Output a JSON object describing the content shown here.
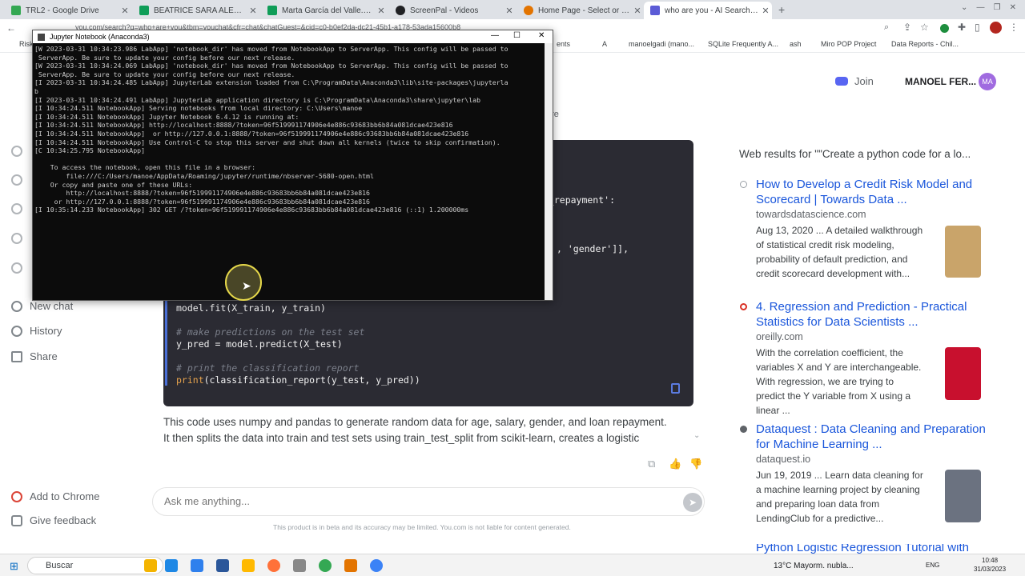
{
  "browser": {
    "tabs": [
      {
        "title": "TRL2 - Google Drive",
        "color": "#34a853"
      },
      {
        "title": "BEATRICE SARA ALEXANDRA.xlsx",
        "color": "#0f9d58"
      },
      {
        "title": "Marta García del Valle.xlsx - Goo",
        "color": "#0f9d58"
      },
      {
        "title": "ScreenPal - Videos",
        "color": "#202124"
      },
      {
        "title": "Home Page - Select or create a",
        "color": "#e37400"
      },
      {
        "title": "who are you - AI Search Based C",
        "color": "#5b5bd6"
      }
    ],
    "url": "you.com/search?q=who+are+you&tbm=youchat&cfr=chat&chatGuest=&cid=c0-b0ef2da-dc21-45b1-a178-53ada15600b8",
    "bookmarks": [
      "Risk",
      "ents",
      "A",
      "manoelgadi (mano...",
      "SQLite Frequently A...",
      "ash",
      "Miro POP Project",
      "Data Reports - Chil..."
    ]
  },
  "header": {
    "join_label": "Join",
    "user_name": "MANOEL FER...",
    "avatar_initials": "MA",
    "more_label": "ore"
  },
  "sidebar": {
    "new_chat": "New chat",
    "history": "History",
    "share": "Share",
    "add_to_chrome": "Add to Chrome",
    "give_feedback": "Give feedback"
  },
  "code": {
    "frag_repayment": "n_repayment':",
    "frag_gender": ", 'gender']],",
    "line_fit": "model.fit(X_train, y_train)",
    "comment_predict": "# make predictions on the test set",
    "line_predict": "y_pred = model.predict(X_test)",
    "comment_print": "# print the classification report",
    "print_kw": "print",
    "print_rest": "(classification_report(y_test, y_pred))"
  },
  "answer": {
    "line1": "This code uses numpy and pandas to generate random data for age, salary, gender, and loan repayment.",
    "line2": "It then splits the data into train and test sets using train_test_split from scikit-learn, creates a logistic"
  },
  "input": {
    "placeholder": "Ask me anything..."
  },
  "disclaimer": "This product is in beta and its accuracy may be limited. You.com is not liable for content generated.",
  "web": {
    "header": "Web results for \"\"Create a python code for a lo...",
    "results": [
      {
        "title": "How to Develop a Credit Risk Model and Scorecard | Towards Data ...",
        "domain": "towardsdatascience.com",
        "snippet": "Aug 13, 2020 ... A detailed walkthrough of statistical credit risk modeling, probability of default prediction, and credit scorecard development with...",
        "icon_color": "#9aa0a6"
      },
      {
        "title": "4. Regression and Prediction - Practical Statistics for Data Scientists ...",
        "domain": "oreilly.com",
        "snippet": "With the correlation coefficient, the variables X and Y are interchangeable. With regression, we are trying to predict the Y variable from X using a linear ...",
        "icon_color": "#d93025"
      },
      {
        "title": "Dataquest : Data Cleaning and Preparation for Machine Learning ...",
        "domain": "dataquest.io",
        "snippet": "Jun 19, 2019 ... Learn data cleaning for a machine learning project by cleaning and preparing loan data from LendingClub for a predictive...",
        "icon_color": "#5f6368"
      },
      {
        "title": "Python Logistic Regression Tutorial with",
        "domain": "",
        "snippet": "",
        "icon_color": "#1a56db"
      }
    ]
  },
  "terminal": {
    "title": "Jupyter Notebook (Anaconda3)",
    "lines": [
      "[W 2023-03-31 10:34:23.986 LabApp] 'notebook_dir' has moved from NotebookApp to ServerApp. This config will be passed to",
      " ServerApp. Be sure to update your config before our next release.",
      "[W 2023-03-31 10:34:24.069 LabApp] 'notebook_dir' has moved from NotebookApp to ServerApp. This config will be passed to",
      " ServerApp. Be sure to update your config before our next release.",
      "[I 2023-03-31 10:34:24.485 LabApp] JupyterLab extension loaded from C:\\ProgramData\\Anaconda3\\lib\\site-packages\\jupyterla",
      "b",
      "[I 2023-03-31 10:34:24.491 LabApp] JupyterLab application directory is C:\\ProgramData\\Anaconda3\\share\\jupyter\\lab",
      "[I 10:34:24.511 NotebookApp] Serving notebooks from local directory: C:\\Users\\manoe",
      "[I 10:34:24.511 NotebookApp] Jupyter Notebook 6.4.12 is running at:",
      "[I 10:34:24.511 NotebookApp] http://localhost:8888/?token=96f519991174906e4e886c93683bb6b84a081dcae423e816",
      "[I 10:34:24.511 NotebookApp]  or http://127.0.0.1:8888/?token=96f519991174906e4e886c93683bb6b84a081dcae423e816",
      "[I 10:34:24.511 NotebookApp] Use Control-C to stop this server and shut down all kernels (twice to skip confirmation).",
      "[C 10:34:25.795 NotebookApp]",
      "",
      "    To access the notebook, open this file in a browser:",
      "        file:///C:/Users/manoe/AppData/Roaming/jupyter/runtime/nbserver-5680-open.html",
      "    Or copy and paste one of these URLs:",
      "        http://localhost:8888/?token=96f519991174906e4e886c93683bb6b84a081dcae423e816",
      "     or http://127.0.0.1:8888/?token=96f519991174906e4e886c93683bb6b84a081dcae423e816",
      "[I 10:35:14.233 NotebookApp] 302 GET /?token=96f519991174906e4e886c93683bb6b84a081dcae423e816 (::1) 1.200000ms"
    ]
  },
  "taskbar": {
    "search_label": "Buscar",
    "weather": "13°C  Mayorm. nubla...",
    "lang": "ENG",
    "time": "10:48",
    "date": "31/03/2023"
  }
}
